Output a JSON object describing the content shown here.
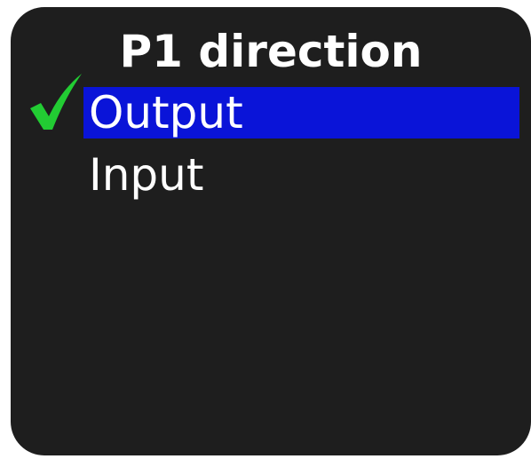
{
  "menu": {
    "title": "P1 direction",
    "items": [
      {
        "label": "Output",
        "checked": true,
        "highlighted": true
      },
      {
        "label": "Input",
        "checked": false,
        "highlighted": false
      }
    ]
  },
  "colors": {
    "screen_background": "#1e1e1e",
    "highlight": "#0a14d8",
    "check": "#22cc33",
    "text": "#ffffff"
  },
  "icons": {
    "selected_marker": "checkmark-icon"
  }
}
